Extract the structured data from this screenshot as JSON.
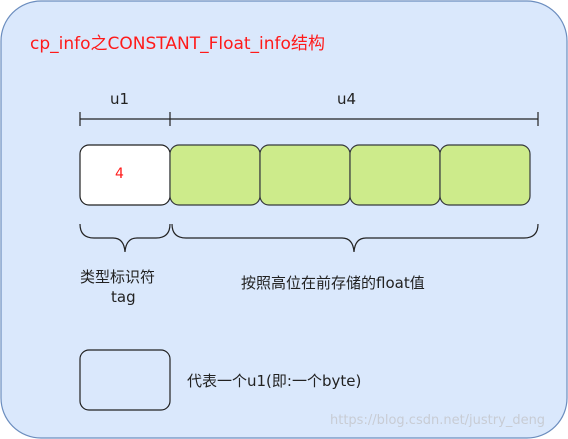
{
  "title": "cp_info之CONSTANT_Float_info结构",
  "fields": {
    "u1_label": "u1",
    "u4_label": "u4",
    "tag_value": "4"
  },
  "captions": {
    "type_line1": "类型标识符",
    "type_line2": "tag",
    "float_desc": "按照高位在前存储的float值"
  },
  "legend": {
    "text": "代表一个u1(即:一个byte)"
  },
  "watermark": "https://blog.csdn.net/justry_deng",
  "colors": {
    "background_panel": "#dae8fc",
    "panel_border": "#6c8ebf",
    "byte_fill": "#cdeb8b",
    "byte_border": "#36393d",
    "tag_fill": "#ffffff",
    "title_color": "#ff1a1a"
  }
}
